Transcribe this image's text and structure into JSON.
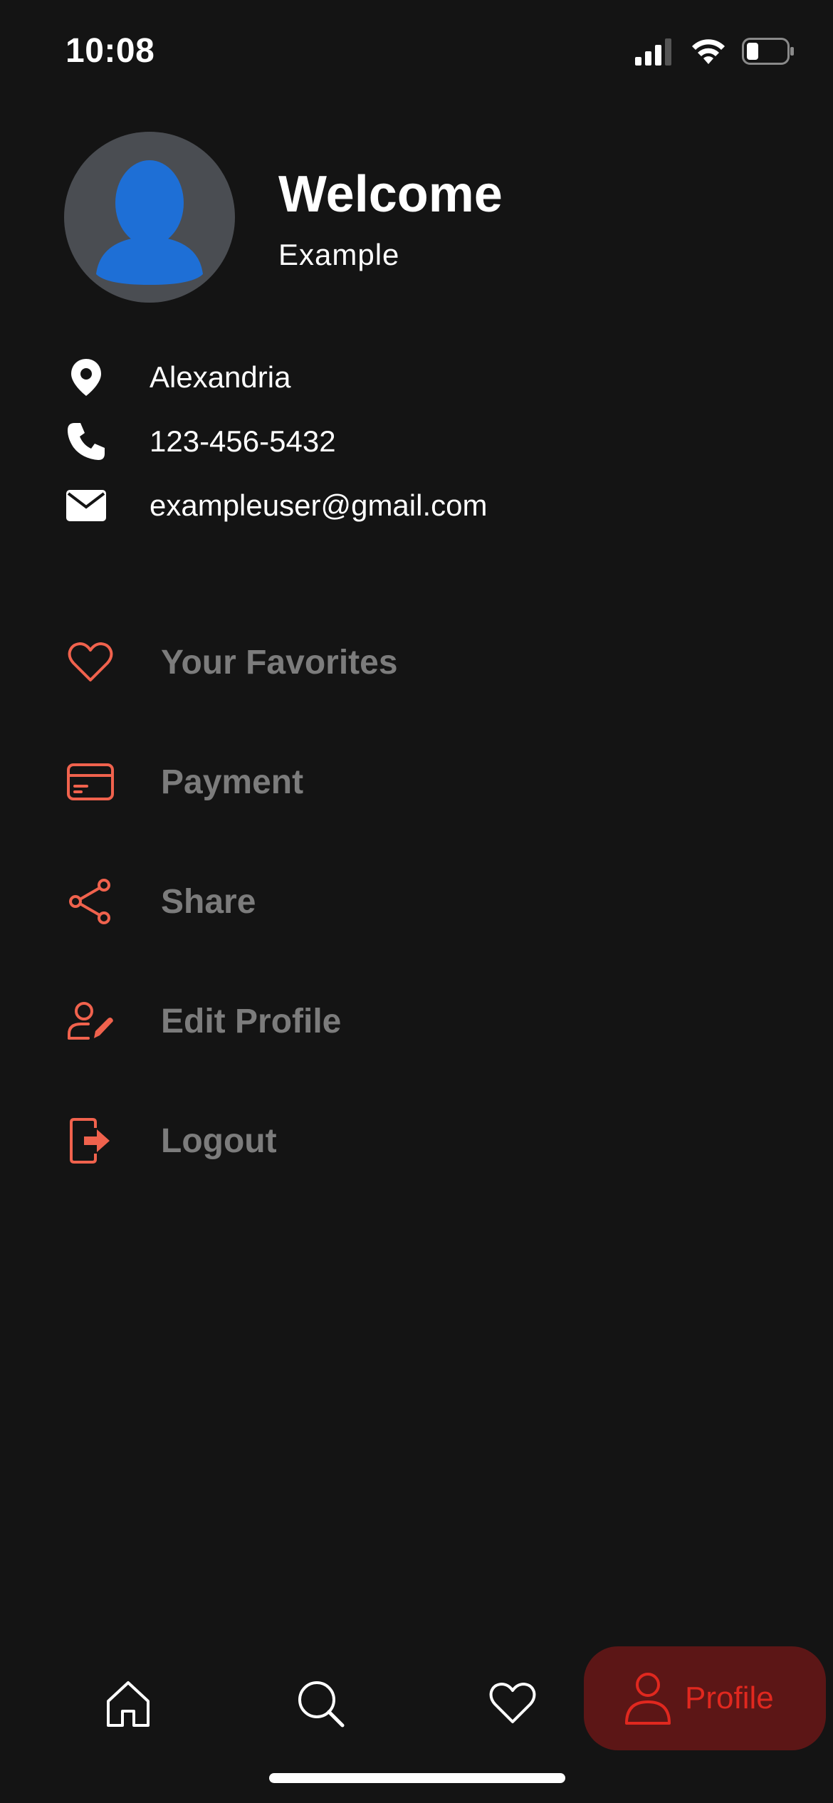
{
  "status_bar": {
    "time": "10:08"
  },
  "header": {
    "welcome": "Welcome",
    "username": "Example"
  },
  "contact": {
    "location": "Alexandria",
    "phone": "123-456-5432",
    "email": "exampleuser@gmail.com"
  },
  "menu": {
    "favorites": "Your Favorites",
    "payment": "Payment",
    "share": "Share",
    "edit_profile": "Edit Profile",
    "logout": "Logout"
  },
  "bottom_nav": {
    "profile_label": "Profile"
  },
  "colors": {
    "background": "#141414",
    "accent": "#f0624d",
    "muted_text": "#7c7c7c",
    "active_red": "#e0281f",
    "active_pill": "#5c1616",
    "avatar_bg": "#4a4d52",
    "avatar_fg": "#1e6fd6"
  },
  "icons": [
    "location-pin-icon",
    "phone-icon",
    "mail-icon",
    "heart-icon",
    "card-icon",
    "share-icon",
    "edit-user-icon",
    "logout-icon",
    "home-icon",
    "search-icon",
    "person-icon"
  ]
}
